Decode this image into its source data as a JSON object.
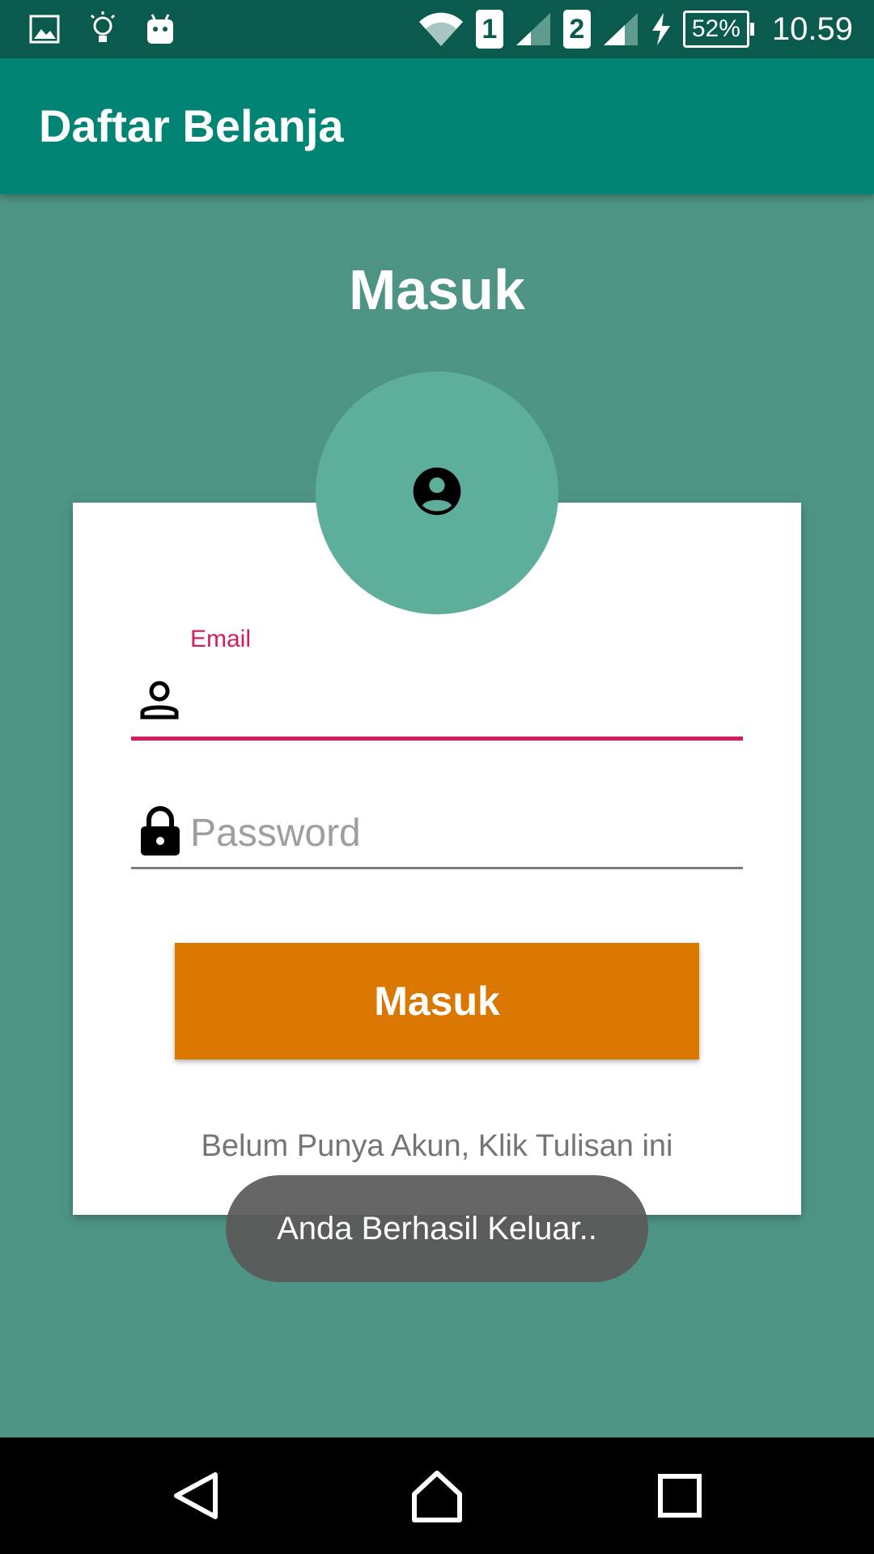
{
  "status_bar": {
    "sim1": "1",
    "sim2": "2",
    "battery": "52%",
    "time": "10.59",
    "icons": [
      "gallery-icon",
      "lightbulb-icon",
      "android-icon",
      "wifi-icon",
      "signal-icon",
      "signal-icon",
      "charging-icon",
      "battery-icon"
    ]
  },
  "app_bar": {
    "title": "Daftar Belanja"
  },
  "screen": {
    "heading": "Masuk"
  },
  "form": {
    "email_label": "Email",
    "email_value": "",
    "password_placeholder": "Password",
    "submit_label": "Masuk",
    "register_text": "Belum Punya Akun, Klik Tulisan ini"
  },
  "toast": {
    "message": "Anda Berhasil Keluar.."
  },
  "colors": {
    "status_bar": "#0a5a4e",
    "app_bar": "#028475",
    "background": "#4e9484",
    "avatar_circle": "#5eae9c",
    "accent": "#d81b60",
    "button": "#d97700"
  }
}
